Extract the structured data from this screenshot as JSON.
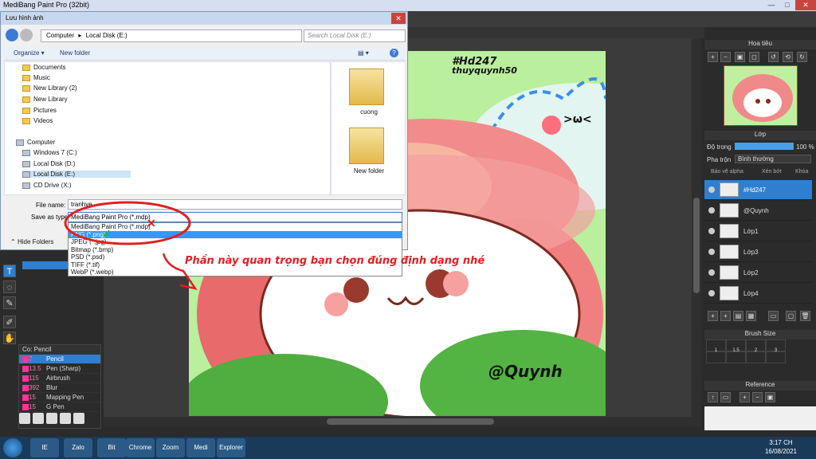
{
  "app": {
    "title": "MediBang Paint Pro (32bit)",
    "min": "—",
    "max": "□",
    "close": "✕"
  },
  "artwork": {
    "hashtag": "#Hd247",
    "username": "thuyquynh50",
    "signature": "@Quynh",
    "face_text": ">ω<"
  },
  "dialog": {
    "title": "Lưu hình ảnh",
    "close": "✕",
    "address": [
      "Computer",
      "Local Disk (E:)"
    ],
    "search_placeholder": "Search Local Disk (E:)",
    "organize": "Organize ▾",
    "new_folder": "New folder",
    "nav_items": [
      {
        "label": "Documents",
        "type": "folder"
      },
      {
        "label": "Music",
        "type": "folder"
      },
      {
        "label": "New Library (2)",
        "type": "folder"
      },
      {
        "label": "New Library",
        "type": "folder"
      },
      {
        "label": "Pictures",
        "type": "folder"
      },
      {
        "label": "Videos",
        "type": "folder"
      },
      {
        "label": "Computer",
        "type": "drive"
      },
      {
        "label": "Windows 7 (C:)",
        "type": "drive"
      },
      {
        "label": "Local Disk (D:)",
        "type": "drive"
      },
      {
        "label": "Local Disk (E:)",
        "type": "drive",
        "selected": true
      },
      {
        "label": "CD Drive (X:)",
        "type": "drive"
      }
    ],
    "files": [
      "cuong",
      "New folder"
    ],
    "filename_label": "File name:",
    "filename_value": "tranhve",
    "savetype_label": "Save as type:",
    "savetype_value": "MediBang Paint Pro (*.mdp)",
    "hide_folders": "Hide Folders",
    "save_types": [
      "MediBang Paint Pro (*.mdp)",
      "PNG (*.png)",
      "JPEG (*.jpg)",
      "Bitmap (*.bmp)",
      "PSD (*.psd)",
      "TIFF (*.tif)",
      "WebP (*.webp)"
    ],
    "highlighted_type_index": 1
  },
  "annotation": {
    "text": "Phần này quan trọng bạn chọn đúng định dạng nhé",
    "color": "#e02020",
    "wrong_mark": "✕",
    "right_mark": "✓"
  },
  "navigator": {
    "title": "Hoa tiêu"
  },
  "layers": {
    "title": "Lớp",
    "opacity_label": "Độ trong",
    "opacity_value": "100 %",
    "blend_label": "Pha trộn",
    "blend_value": "Bình thường",
    "protect_alpha": "Bảo vệ alpha",
    "clipping": "Xén bớt",
    "lock": "Khóa",
    "items": [
      {
        "name": "#Hd247",
        "selected": true
      },
      {
        "name": "@Quynh"
      },
      {
        "name": "Lớp1"
      },
      {
        "name": "Lớp3"
      },
      {
        "name": "Lớp2"
      },
      {
        "name": "Lớp4"
      }
    ]
  },
  "brush_size": {
    "title": "Brush Size",
    "sizes": [
      "1",
      "1.5",
      "2",
      "3"
    ]
  },
  "reference": {
    "title": "Reference"
  },
  "brush_panel": {
    "title": "Co: Pencil",
    "items": [
      {
        "size": "7",
        "name": "Pencil",
        "selected": true
      },
      {
        "size": "13.5",
        "name": "Pen (Sharp)"
      },
      {
        "size": "115",
        "name": "Airbrush"
      },
      {
        "size": "392",
        "name": "Blur"
      },
      {
        "size": "15",
        "name": "Mapping Pen"
      },
      {
        "size": "15",
        "name": "G Pen"
      }
    ]
  },
  "taskbar": {
    "items": [
      "IE",
      "Zalo",
      "Bit",
      "Chrome",
      "Zoom",
      "Medi",
      "Explorer"
    ],
    "time": "3:17 CH",
    "date": "16/08/2021"
  }
}
